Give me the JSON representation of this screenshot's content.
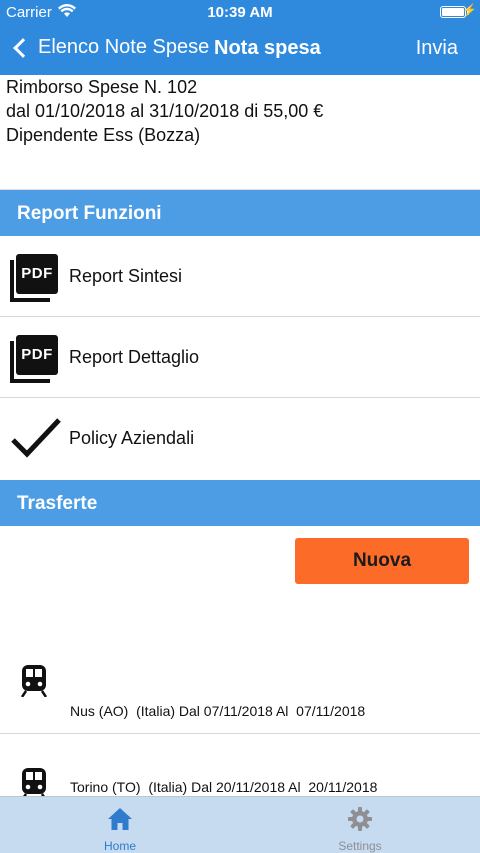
{
  "status": {
    "carrier": "Carrier",
    "time": "10:39 AM"
  },
  "nav": {
    "back_label": "Elenco Note Spese",
    "title": "Nota spesa",
    "action": "Invia"
  },
  "header": {
    "line1": "Rimborso Spese N. 102",
    "line2": "dal 01/10/2018 al 31/10/2018 di 55,00 €",
    "line3": "Dipendente Ess (Bozza)"
  },
  "report_section": {
    "title": "Report Funzioni",
    "items": [
      {
        "label": "Report Sintesi",
        "icon": "pdf-icon",
        "icon_text": "PDF"
      },
      {
        "label": "Report Dettaglio",
        "icon": "pdf-icon",
        "icon_text": "PDF"
      },
      {
        "label": "Policy Aziendali",
        "icon": "checkmark-icon"
      }
    ]
  },
  "trasferte_section": {
    "title": "Trasferte",
    "new_button": "Nuova",
    "trips": [
      {
        "icon": "train-icon",
        "text": "Nus (AO)  (Italia) Dal 07/11/2018 Al  07/11/2018"
      },
      {
        "icon": "train-icon",
        "text": "Torino (TO)  (Italia) Dal 20/11/2018 Al  20/11/2018"
      }
    ]
  },
  "tabbar": {
    "tabs": [
      {
        "label": "Home",
        "icon": "home-icon",
        "active": true
      },
      {
        "label": "Settings",
        "icon": "gear-icon",
        "active": false
      }
    ]
  },
  "colors": {
    "nav_bar": "#2f8ade",
    "section_header": "#4d9de5",
    "new_button": "#fc6b28",
    "tabbar": "#c6dbf0",
    "tab_active": "#2f7bcc",
    "tab_inactive": "#8e8e93"
  }
}
